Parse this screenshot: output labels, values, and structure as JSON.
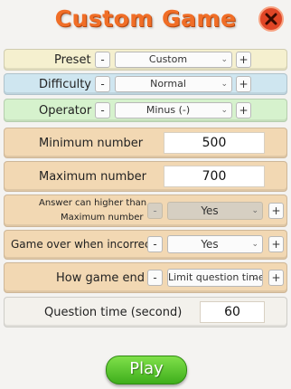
{
  "title": "Custom Game",
  "colors": {
    "title": "#f06e27",
    "preset_row": "#f5f0cf",
    "difficulty_row": "#cfe6f0",
    "operator_row": "#d6f2cd",
    "setting_row": "#f2d8b3",
    "play_button": "#4fc027",
    "close_button": "#e04626"
  },
  "preset": {
    "label": "Preset",
    "value": "Custom",
    "minus": "-",
    "plus": "+"
  },
  "difficulty": {
    "label": "Difficulty",
    "value": "Normal",
    "minus": "-",
    "plus": "+"
  },
  "operator": {
    "label": "Operator",
    "value": "Minus (-)",
    "minus": "-",
    "plus": "+"
  },
  "minimum": {
    "label": "Minimum number",
    "value": "500"
  },
  "maximum": {
    "label": "Maximum number",
    "value": "700"
  },
  "answer_higher": {
    "label_line1": "Answer can higher than",
    "label_line2": "Maximum number",
    "value": "Yes",
    "minus": "-",
    "plus": "+"
  },
  "game_over": {
    "label": "Game over when incorrect",
    "value": "Yes",
    "minus": "-",
    "plus": "+"
  },
  "how_end": {
    "label": "How game end",
    "value": "Limit question time",
    "minus": "-",
    "plus": "+"
  },
  "question_time": {
    "label": "Question time (second)",
    "value": "60"
  },
  "play": "Play"
}
